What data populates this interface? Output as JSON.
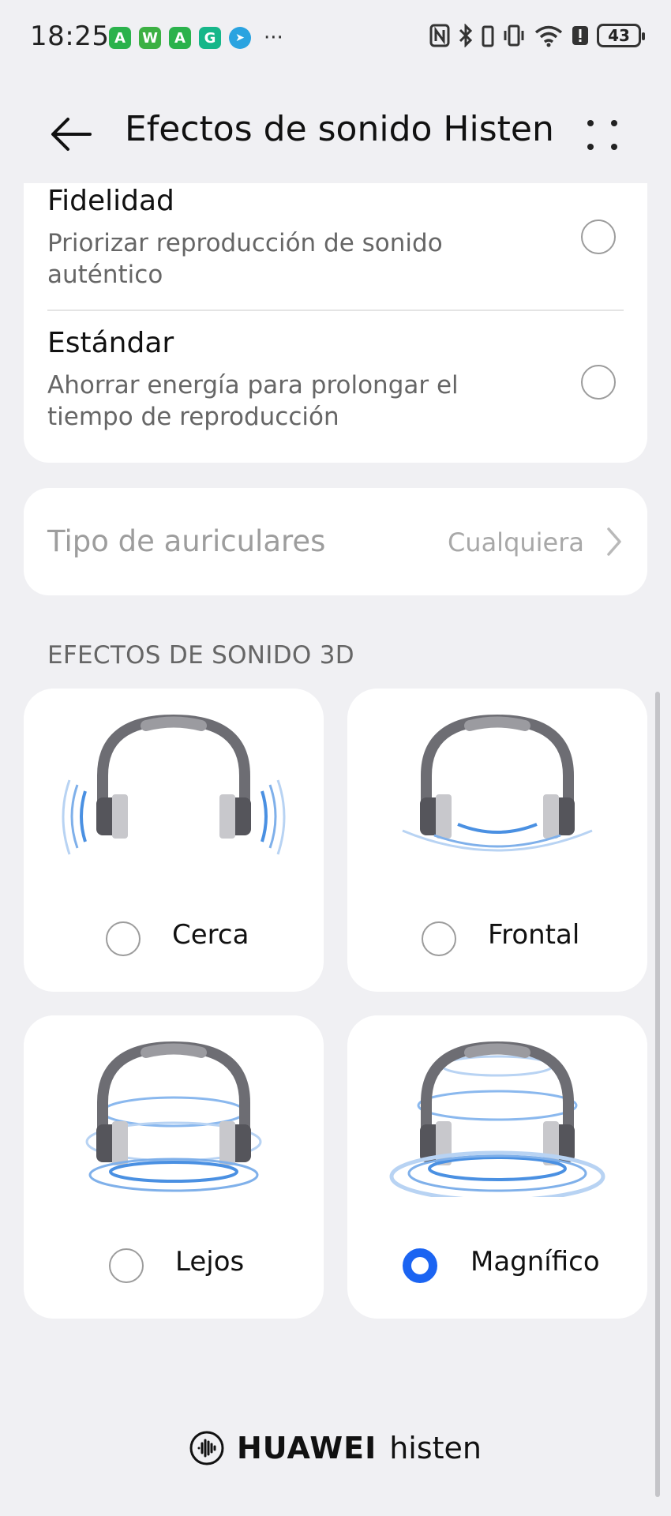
{
  "status_bar": {
    "time": "18:25",
    "battery": "43",
    "apps": [
      {
        "icon": "app-a-icon",
        "letter": "A",
        "color": "#2bb24c"
      },
      {
        "icon": "app-w-icon",
        "letter": "W",
        "color": "#3cb043"
      },
      {
        "icon": "app-a2-icon",
        "letter": "A",
        "color": "#2bb24c"
      },
      {
        "icon": "app-g-icon",
        "letter": "G",
        "color": "#16b689"
      },
      {
        "icon": "telegram-icon",
        "letter": "➤",
        "color": "#2aa3e0"
      }
    ],
    "more": "···"
  },
  "header": {
    "title": "Efectos de sonido Histen"
  },
  "modes": [
    {
      "title": "Fidelidad",
      "desc": "Priorizar reproducción de sonido auténtico",
      "checked": false
    },
    {
      "title": "Estándar",
      "desc": "Ahorrar energía para prolongar el tiempo de reproducción",
      "checked": false
    }
  ],
  "headphone_type": {
    "label": "Tipo de auriculares",
    "value": "Cualquiera"
  },
  "section_3d": {
    "title": "EFECTOS DE SONIDO 3D"
  },
  "effects": [
    {
      "label": "Cerca",
      "checked": false
    },
    {
      "label": "Frontal",
      "checked": false
    },
    {
      "label": "Lejos",
      "checked": false
    },
    {
      "label": "Magnífico",
      "checked": true
    }
  ],
  "colors": {
    "accent": "#1b64f2",
    "wave": "#4a90e2"
  },
  "footer": {
    "brand": "HUAWEI",
    "product": "histen"
  }
}
